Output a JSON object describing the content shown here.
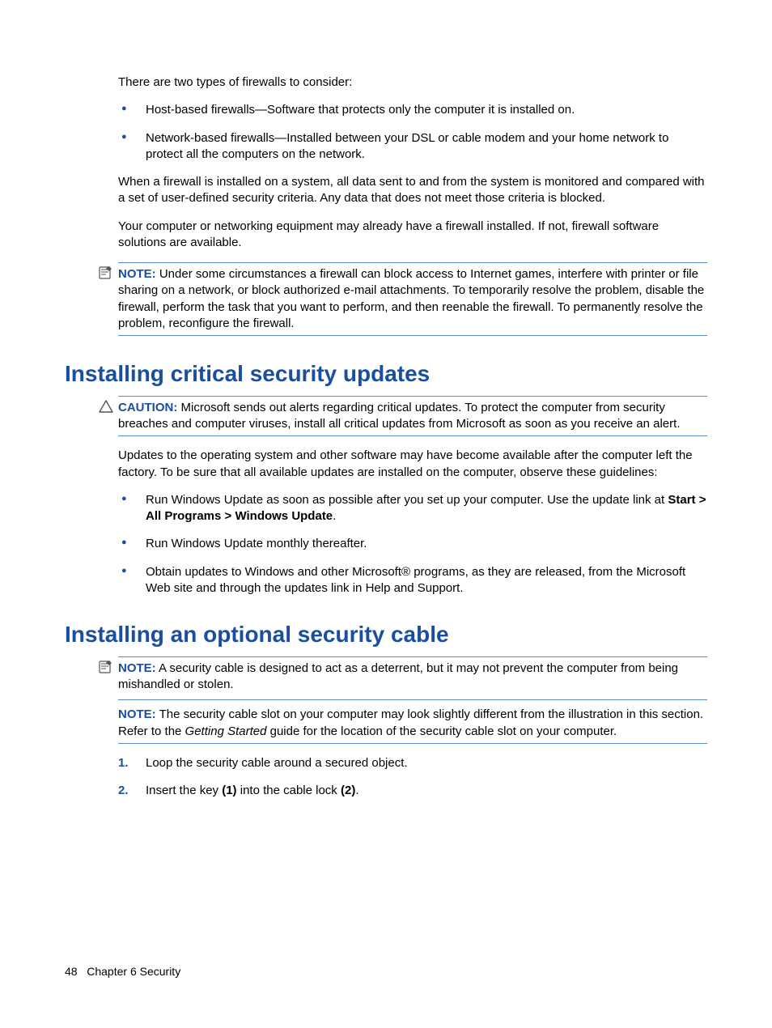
{
  "intro": {
    "p1": "There are two types of firewalls to consider:",
    "bullets": [
      "Host-based firewalls—Software that protects only the computer it is installed on.",
      "Network-based firewalls—Installed between your DSL or cable modem and your home network to protect all the computers on the network."
    ],
    "p2": "When a firewall is installed on a system, all data sent to and from the system is monitored and compared with a set of user-defined security criteria. Any data that does not meet those criteria is blocked.",
    "p3": "Your computer or networking equipment may already have a firewall installed. If not, firewall software solutions are available.",
    "note_label": "NOTE:",
    "note_body": "Under some circumstances a firewall can block access to Internet games, interfere with printer or file sharing on a network, or block authorized e-mail attachments. To temporarily resolve the problem, disable the firewall, perform the task that you want to perform, and then reenable the firewall. To permanently resolve the problem, reconfigure the firewall."
  },
  "sec1": {
    "heading": "Installing critical security updates",
    "caution_label": "CAUTION:",
    "caution_body": "Microsoft sends out alerts regarding critical updates. To protect the computer from security breaches and computer viruses, install all critical updates from Microsoft as soon as you receive an alert.",
    "p1": "Updates to the operating system and other software may have become available after the computer left the factory. To be sure that all available updates are installed on the computer, observe these guidelines:",
    "bullet1_a": "Run Windows Update as soon as possible after you set up your computer. Use the update link at ",
    "bullet1_b": "Start > All Programs > Windows Update",
    "bullet1_c": ".",
    "bullet2": "Run Windows Update monthly thereafter.",
    "bullet3": "Obtain updates to Windows and other Microsoft® programs, as they are released, from the Microsoft Web site and through the updates link in Help and Support."
  },
  "sec2": {
    "heading": "Installing an optional security cable",
    "note1_label": "NOTE:",
    "note1_body": "A security cable is designed to act as a deterrent, but it may not prevent the computer from being mishandled or stolen.",
    "note2_label": "NOTE:",
    "note2_a": "The security cable slot on your computer may look slightly different from the illustration in this section. Refer to the ",
    "note2_b": "Getting Started",
    "note2_c": " guide for the location of the security cable slot on your computer.",
    "step1": "Loop the security cable around a secured object.",
    "step2_a": "Insert the key ",
    "step2_b": "(1)",
    "step2_c": " into the cable lock ",
    "step2_d": "(2)",
    "step2_e": "."
  },
  "footer": {
    "page": "48",
    "chapter": "Chapter 6   Security"
  }
}
